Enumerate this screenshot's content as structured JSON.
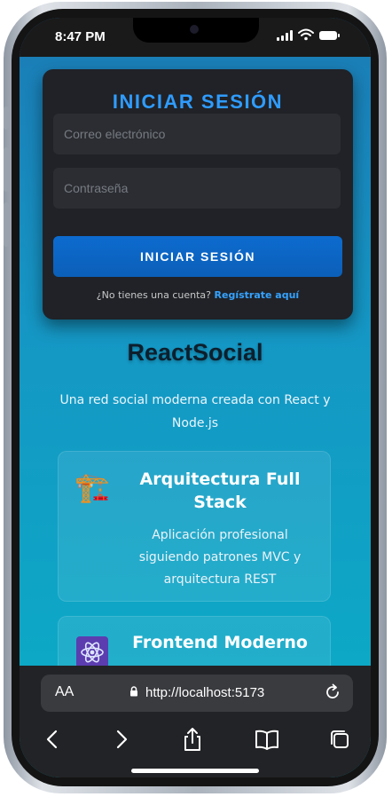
{
  "status": {
    "time": "8:47 PM"
  },
  "login": {
    "title": "INICIAR SESIÓN",
    "email_placeholder": "Correo electrónico",
    "password_placeholder": "Contraseña",
    "submit_label": "INICIAR SESIÓN",
    "no_account_text": "¿No tienes una cuenta?",
    "register_link": "Regístrate aquí"
  },
  "brand": {
    "name": "ReactSocial",
    "tagline": "Una red social moderna creada con React y Node.js"
  },
  "features": [
    {
      "icon": "construction-crane-icon",
      "title": "Arquitectura Full Stack",
      "description": "Aplicación profesional siguiendo patrones MVC y arquitectura REST"
    },
    {
      "icon": "react-atom-icon",
      "title": "Frontend Moderno",
      "description": ""
    }
  ],
  "browser": {
    "text_size_label": "AA",
    "url": "http://localhost:5173"
  },
  "colors": {
    "accent": "#2f9cff",
    "button": "#0d6bcf",
    "card": "#202227",
    "background_top": "#1b7bb5",
    "background_bottom": "#0aaec7"
  }
}
